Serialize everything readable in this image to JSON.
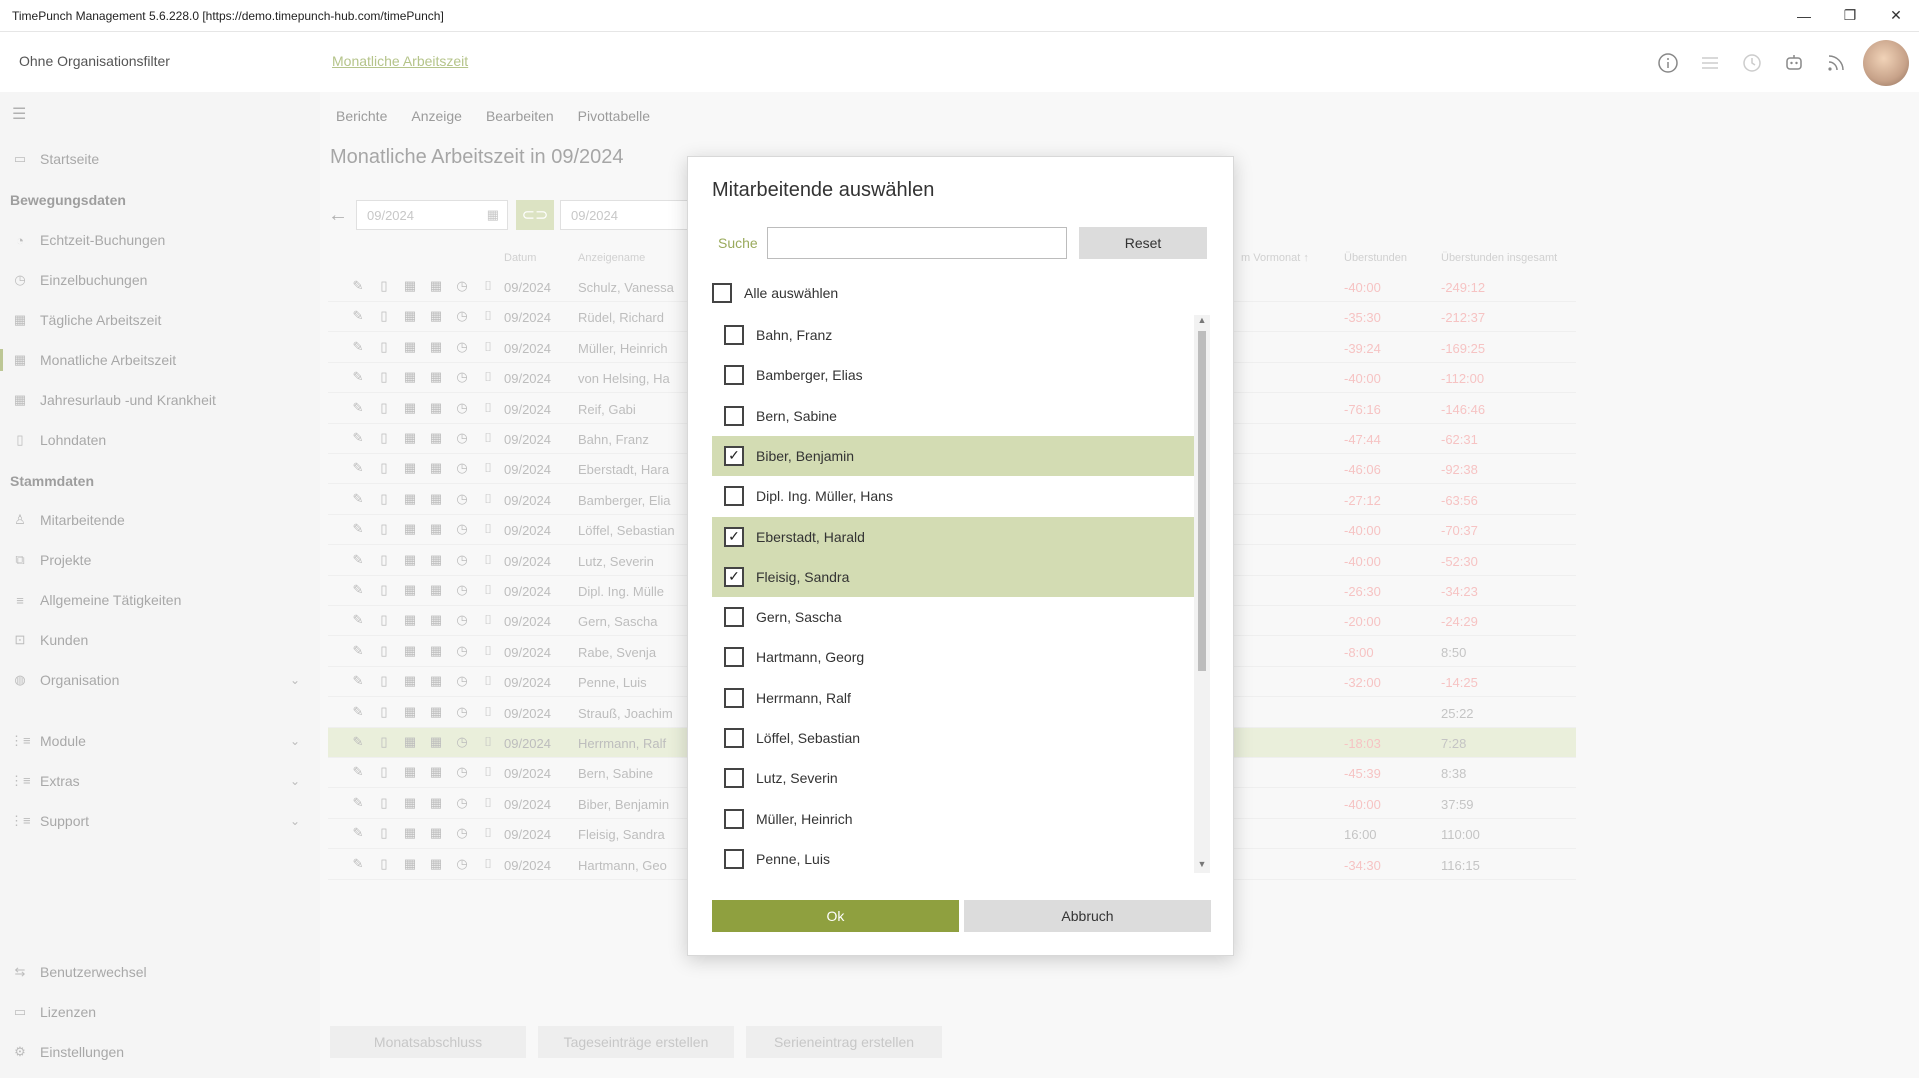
{
  "window": {
    "title": "TimePunch Management 5.6.228.0 [https://demo.timepunch-hub.com/timePunch]",
    "minimize": "—",
    "restore": "❐",
    "close": "✕"
  },
  "topbar": {
    "org_filter": "Ohne Organisationsfilter",
    "breadcrumb": "Monatliche Arbeitszeit",
    "icons": [
      "info-icon",
      "list-icon",
      "history-icon",
      "robot-icon",
      "feed-icon",
      "avatar"
    ]
  },
  "sidebar": {
    "items": [
      {
        "label": "Startseite",
        "icon": "home-icon"
      },
      {
        "label": "Bewegungsdaten",
        "type": "heading"
      },
      {
        "label": "Echtzeit-Buchungen",
        "icon": "realtime-icon"
      },
      {
        "label": "Einzelbuchungen",
        "icon": "clock-icon"
      },
      {
        "label": "Tägliche Arbeitszeit",
        "icon": "calendar-icon"
      },
      {
        "label": "Monatliche Arbeitszeit",
        "icon": "calendar-month-icon",
        "active": true
      },
      {
        "label": "Jahresurlaub -und Krankheit",
        "icon": "calendar-year-icon"
      },
      {
        "label": "Lohndaten",
        "icon": "document-icon"
      },
      {
        "label": "Stammdaten",
        "type": "heading"
      },
      {
        "label": "Mitarbeitende",
        "icon": "person-icon"
      },
      {
        "label": "Projekte",
        "icon": "project-icon"
      },
      {
        "label": "Allgemeine Tätigkeiten",
        "icon": "list-icon"
      },
      {
        "label": "Kunden",
        "icon": "customer-icon"
      },
      {
        "label": "Organisation",
        "icon": "globe-icon",
        "expandable": true
      },
      {
        "label": "Module",
        "icon": "list-icon",
        "expandable": true
      },
      {
        "label": "Extras",
        "icon": "list-icon",
        "expandable": true
      },
      {
        "label": "Support",
        "icon": "list-icon",
        "expandable": true
      }
    ],
    "bottom": [
      {
        "label": "Benutzerwechsel",
        "icon": "switch-user-icon"
      },
      {
        "label": "Lizenzen",
        "icon": "license-icon"
      },
      {
        "label": "Einstellungen",
        "icon": "gear-icon"
      }
    ]
  },
  "main": {
    "menu": [
      "Berichte",
      "Anzeige",
      "Bearbeiten",
      "Pivottabelle"
    ],
    "title": "Monatliche Arbeitszeit in 09/2024",
    "date_from": "09/2024",
    "date_to": "09/2024",
    "columns": {
      "datum": "Datum",
      "name": "Anzeigename",
      "vormonat": "m Vormonat",
      "ueberstunden": "Überstunden",
      "ueberstunden_gesamt": "Überstunden insgesamt"
    },
    "rows": [
      {
        "date": "09/2024",
        "name": "Schulz, Vanessa",
        "ot": "-40:00",
        "total": "-249:12"
      },
      {
        "date": "09/2024",
        "name": "Rüdel, Richard",
        "ot": "-35:30",
        "total": "-212:37"
      },
      {
        "date": "09/2024",
        "name": "Müller, Heinrich",
        "ot": "-39:24",
        "total": "-169:25"
      },
      {
        "date": "09/2024",
        "name": "von Helsing, Ha",
        "ot": "-40:00",
        "total": "-112:00"
      },
      {
        "date": "09/2024",
        "name": "Reif, Gabi",
        "ot": "-76:16",
        "total": "-146:46"
      },
      {
        "date": "09/2024",
        "name": "Bahn, Franz",
        "ot": "-47:44",
        "total": "-62:31"
      },
      {
        "date": "09/2024",
        "name": "Eberstadt, Hara",
        "ot": "-46:06",
        "total": "-92:38"
      },
      {
        "date": "09/2024",
        "name": "Bamberger, Elia",
        "ot": "-27:12",
        "total": "-63:56"
      },
      {
        "date": "09/2024",
        "name": "Löffel, Sebastian",
        "ot": "-40:00",
        "total": "-70:37"
      },
      {
        "date": "09/2024",
        "name": "Lutz, Severin",
        "ot": "-40:00",
        "total": "-52:30"
      },
      {
        "date": "09/2024",
        "name": "Dipl. Ing. Mülle",
        "ot": "-26:30",
        "total": "-34:23"
      },
      {
        "date": "09/2024",
        "name": "Gern, Sascha",
        "ot": "-20:00",
        "total": "-24:29"
      },
      {
        "date": "09/2024",
        "name": "Rabe, Svenja",
        "ot": "-8:00",
        "total": "8:50"
      },
      {
        "date": "09/2024",
        "name": "Penne, Luis",
        "ot": "-32:00",
        "total": "-14:25"
      },
      {
        "date": "09/2024",
        "name": "Strauß, Joachim",
        "ot": "",
        "total": "25:22"
      },
      {
        "date": "09/2024",
        "name": "Herrmann, Ralf",
        "ot": "-18:03",
        "total": "7:28",
        "selected": true
      },
      {
        "date": "09/2024",
        "name": "Bern, Sabine",
        "ot": "-45:39",
        "total": "8:38"
      },
      {
        "date": "09/2024",
        "name": "Biber, Benjamin",
        "ot": "-40:00",
        "total": "37:59"
      },
      {
        "date": "09/2024",
        "name": "Fleisig, Sandra",
        "ot": "16:00",
        "total": "110:00"
      },
      {
        "date": "09/2024",
        "name": "Hartmann, Geo",
        "ot": "-34:30",
        "total": "116:15"
      }
    ],
    "bottom_buttons": [
      "Monatsabschluss",
      "Tageseinträge erstellen",
      "Serieneintrag erstellen"
    ]
  },
  "dialog": {
    "title": "Mitarbeitende auswählen",
    "search_label": "Suche",
    "search_value": "",
    "reset": "Reset",
    "select_all": "Alle auswählen",
    "employees": [
      {
        "name": "Bahn, Franz",
        "checked": false
      },
      {
        "name": "Bamberger, Elias",
        "checked": false
      },
      {
        "name": "Bern, Sabine",
        "checked": false
      },
      {
        "name": "Biber, Benjamin",
        "checked": true
      },
      {
        "name": "Dipl. Ing. Müller, Hans",
        "checked": false
      },
      {
        "name": "Eberstadt, Harald",
        "checked": true
      },
      {
        "name": "Fleisig, Sandra",
        "checked": true
      },
      {
        "name": "Gern, Sascha",
        "checked": false
      },
      {
        "name": "Hartmann, Georg",
        "checked": false
      },
      {
        "name": "Herrmann, Ralf",
        "checked": false
      },
      {
        "name": "Löffel, Sebastian",
        "checked": false
      },
      {
        "name": "Lutz, Severin",
        "checked": false
      },
      {
        "name": "Müller, Heinrich",
        "checked": false
      },
      {
        "name": "Penne, Luis",
        "checked": false
      }
    ],
    "ok": "Ok",
    "cancel": "Abbruch"
  }
}
